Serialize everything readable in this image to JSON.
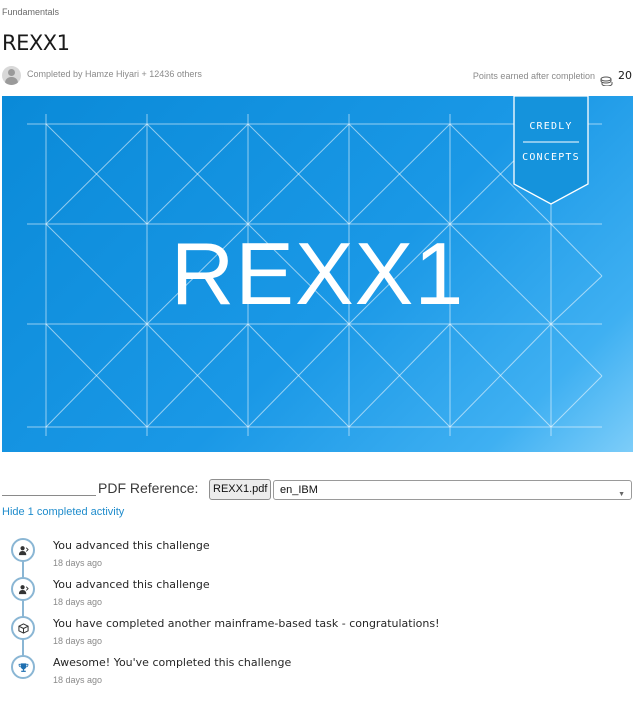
{
  "breadcrumb": "Fundamentals",
  "page_title": "REXX1",
  "completed_by": "Completed by Hamze Hiyari + 12436 others",
  "points": {
    "label": "Points earned after completion",
    "value": "20"
  },
  "banner": {
    "title": "REXX1",
    "badge_line1": "CREDLY",
    "badge_line2": "CONCEPTS",
    "colors": {
      "start": "#0a8ad8",
      "end": "#7dcdf9"
    }
  },
  "pdf": {
    "label": "PDF Reference:",
    "file_button": "REXX1.pdf",
    "language_selected": "en_IBM"
  },
  "hide_link": "Hide 1 completed activity",
  "activities": [
    {
      "text": "You advanced this challenge",
      "time": "18 days ago",
      "icon": "user-advance-icon"
    },
    {
      "text": "You advanced this challenge",
      "time": "18 days ago",
      "icon": "user-advance-icon"
    },
    {
      "text": "You have completed another mainframe-based task - congratulations!",
      "time": "18 days ago",
      "icon": "cube-icon"
    },
    {
      "text": "Awesome! You've completed this challenge",
      "time": "18 days ago",
      "icon": "trophy-icon"
    }
  ],
  "accent_color": "#1f8ccc",
  "timeline_color": "#8ab6d4"
}
